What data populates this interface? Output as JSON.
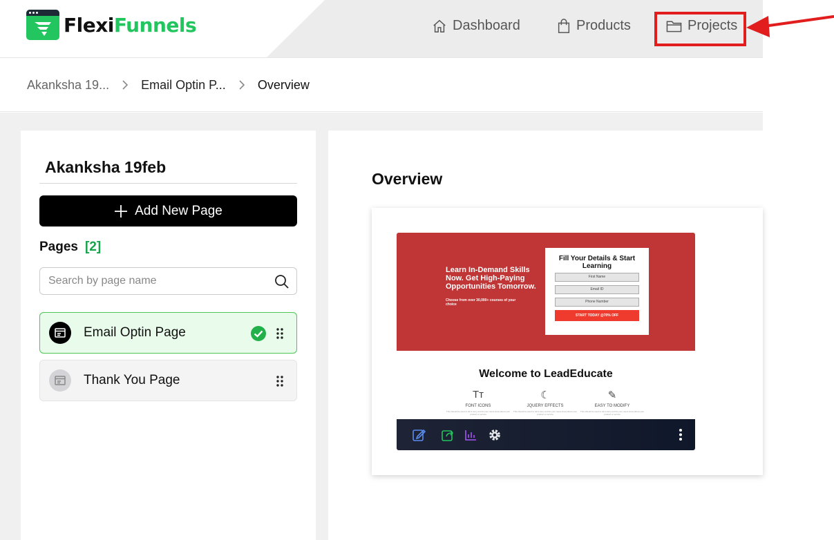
{
  "header": {
    "logo_part1": "Flexi",
    "logo_part2": "Funnels",
    "nav": {
      "dashboard": "Dashboard",
      "products": "Products",
      "projects": "Projects"
    }
  },
  "breadcrumb": {
    "items": [
      "Akanksha 19...",
      "Email Optin P...",
      "Overview"
    ]
  },
  "left_panel": {
    "project_title": "Akanksha 19feb",
    "add_button": "Add New Page",
    "pages_label": "Pages",
    "pages_count": "[2]",
    "search_placeholder": "Search by page name",
    "pages": [
      {
        "name": "Email Optin Page",
        "active": true
      },
      {
        "name": "Thank You Page",
        "active": false
      }
    ]
  },
  "right_panel": {
    "title": "Overview",
    "preview": {
      "hero_heading": "Learn In-Demand Skills Now. Get High-Paying Opportunities Tomorrow.",
      "hero_sub": "Choose from over 30,000+ courses of your choice",
      "form_title": "Fill Your Details & Start Learning",
      "field_first_name": "First Name",
      "field_email": "Email ID",
      "field_phone": "Phone Number",
      "form_button": "START TODAY @70% OFF",
      "welcome": "Welcome to LeadEducate",
      "features": [
        {
          "icon": "font-icon",
          "label": "FONT ICONS"
        },
        {
          "icon": "jquery-icon",
          "label": "JQUERY EFFECTS"
        },
        {
          "icon": "edit-icon",
          "label": "EASY TO MODIFY"
        }
      ],
      "feature_text": "This should be used to tell a story and let your users know about your product or service"
    }
  },
  "colors": {
    "brand_green": "#22c55e",
    "highlight_red": "#e11d1d",
    "hero_red": "#c03535"
  }
}
